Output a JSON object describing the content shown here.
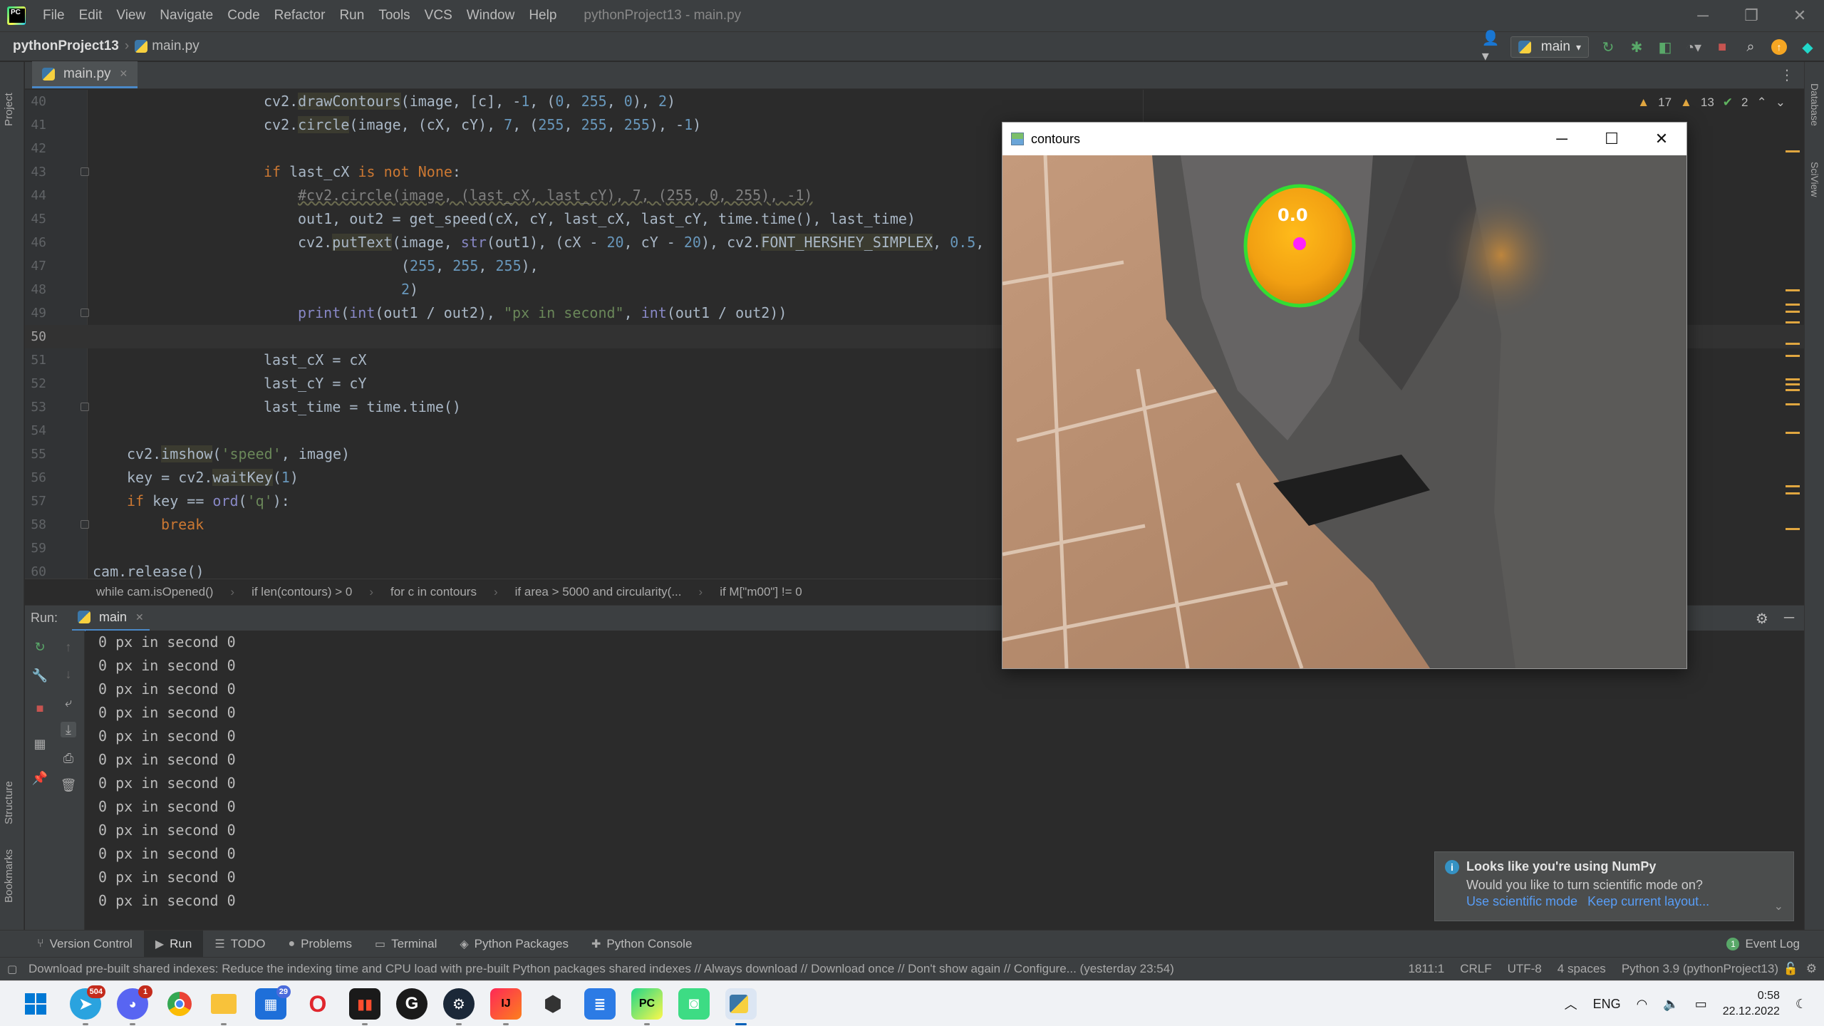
{
  "menubar": {
    "items": [
      "File",
      "Edit",
      "View",
      "Navigate",
      "Code",
      "Refactor",
      "Run",
      "Tools",
      "VCS",
      "Window",
      "Help"
    ],
    "title": "pythonProject13 - main.py"
  },
  "navbar": {
    "project": "pythonProject13",
    "file": "main.py",
    "run_config": "main"
  },
  "left_strip": {
    "project": "Project",
    "structure": "Structure",
    "bookmarks": "Bookmarks"
  },
  "right_strip": {
    "database": "Database",
    "sciview": "SciView"
  },
  "editor": {
    "tab": "main.py",
    "inspections": {
      "warnings": "17",
      "weak_warnings": "13",
      "ok": "2"
    },
    "lines": [
      {
        "n": "40",
        "indent": 10
      },
      {
        "n": "41",
        "indent": 10
      },
      {
        "n": "42",
        "indent": 0
      },
      {
        "n": "43",
        "indent": 10
      },
      {
        "n": "44",
        "indent": 12
      },
      {
        "n": "45",
        "indent": 12
      },
      {
        "n": "46",
        "indent": 12
      },
      {
        "n": "47",
        "indent": 18
      },
      {
        "n": "48",
        "indent": 18
      },
      {
        "n": "49",
        "indent": 12
      },
      {
        "n": "50",
        "indent": 0
      },
      {
        "n": "51",
        "indent": 10
      },
      {
        "n": "52",
        "indent": 10
      },
      {
        "n": "53",
        "indent": 10
      },
      {
        "n": "54",
        "indent": 0
      },
      {
        "n": "55",
        "indent": 2
      },
      {
        "n": "56",
        "indent": 2
      },
      {
        "n": "57",
        "indent": 2
      },
      {
        "n": "58",
        "indent": 4
      },
      {
        "n": "59",
        "indent": 0
      },
      {
        "n": "60",
        "indent": 0
      }
    ]
  },
  "breadcrumbs": [
    "while cam.isOpened()",
    "if len(contours) > 0",
    "for c in contours",
    "if area > 5000 and circularity(...",
    "if M[\"m00\"] != 0"
  ],
  "run": {
    "label": "Run:",
    "tab": "main",
    "output_line": "0 px in second 0",
    "output_count": 12
  },
  "tooltabs": [
    "Version Control",
    "Run",
    "TODO",
    "Problems",
    "Terminal",
    "Python Packages",
    "Python Console"
  ],
  "event_log": "Event Log",
  "status": {
    "message": "Download pre-built shared indexes: Reduce the indexing time and CPU load with pre-built Python packages shared indexes // Always download // Download once // Don't show again // Configure... (yesterday 23:54)",
    "position": "1811:1",
    "line_sep": "CRLF",
    "encoding": "UTF-8",
    "indent": "4 spaces",
    "interpreter": "Python 3.9 (pythonProject13)"
  },
  "balloon": {
    "title": "Looks like you're using NumPy",
    "text": "Would you like to turn scientific mode on?",
    "link1": "Use scientific mode",
    "link2": "Keep current layout..."
  },
  "cv_window": {
    "title": "contours",
    "speed_text": "0.0"
  },
  "taskbar": {
    "telegram_badge": "504",
    "discord_badge": "1",
    "mail_badge": "29",
    "lang": "ENG",
    "time": "0:58",
    "date": "22.12.2022"
  },
  "colors": {
    "editor_bg": "#2b2b2b",
    "chrome_bg": "#3c3f41",
    "accent": "#4a88c7",
    "keyword": "#cc7832",
    "number": "#6897bb",
    "string": "#6a8759"
  }
}
